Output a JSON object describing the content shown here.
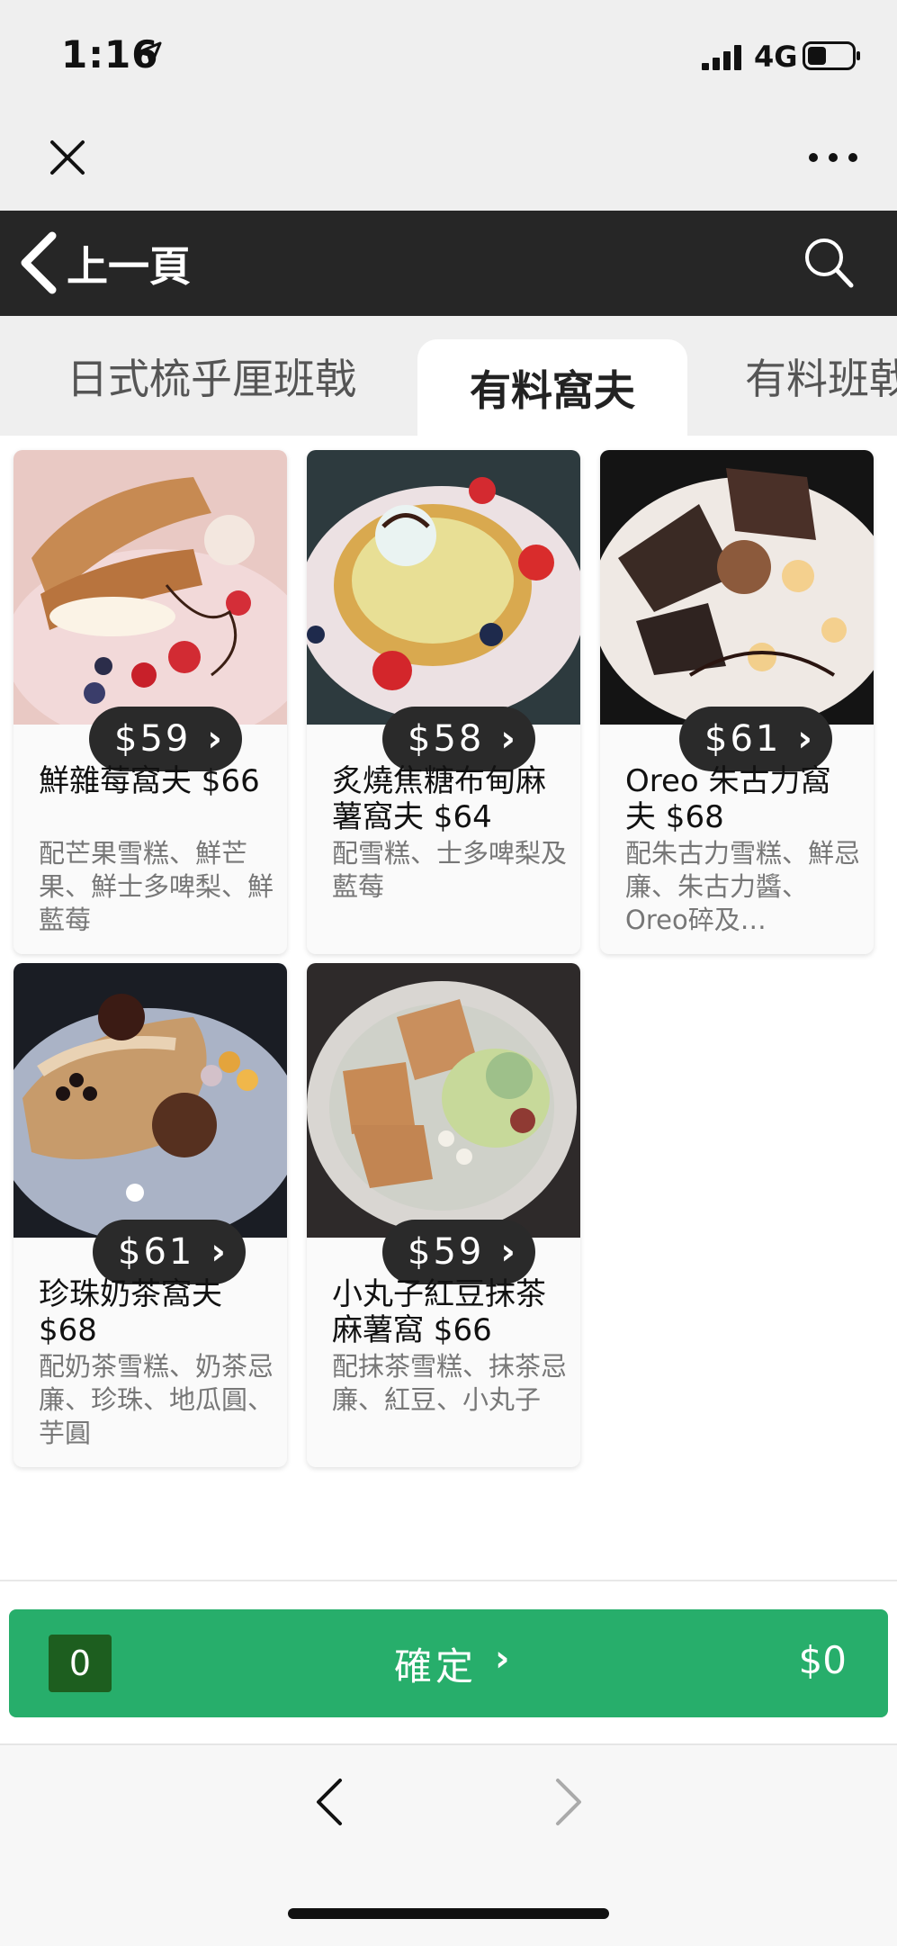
{
  "status": {
    "time": "1:16",
    "network": "4G",
    "icons": [
      "location-arrow-icon",
      "signal-icon",
      "battery-icon"
    ]
  },
  "wechat_bar": {
    "close_icon": "close-icon",
    "more_icon": "more-icon"
  },
  "nav": {
    "back_label": "上一頁",
    "search_icon": "search-icon"
  },
  "tabs": [
    {
      "label": "日式梳乎厘班戟",
      "active": false
    },
    {
      "label": "有料窩夫",
      "active": true
    },
    {
      "label": "有料班戟",
      "active": false
    }
  ],
  "products": [
    {
      "price": "$59",
      "title": "鮮雜莓窩夫 $66",
      "desc": "配芒果雪糕、鮮芒果、鮮士多啤梨、鮮藍莓"
    },
    {
      "price": "$58",
      "title": "炙燒焦糖布甸麻薯窩夫 $64",
      "desc": "配雪糕、士多啤梨及藍莓"
    },
    {
      "price": "$61",
      "title": "Oreo 朱古力窩夫 $68",
      "desc": "配朱古力雪糕、鮮忌廉、朱古力醬、Oreo碎及…"
    },
    {
      "price": "$61",
      "title": "珍珠奶茶窩夫 $68",
      "desc": "配奶茶雪糕、奶茶忌廉、珍珠、地瓜圓、芋圓"
    },
    {
      "price": "$59",
      "title": "小丸子紅豆抹茶麻薯窩 $66",
      "desc": "配抹茶雪糕、抹茶忌廉、紅豆、小丸子"
    }
  ],
  "cart": {
    "quantity": "0",
    "confirm_label": "確定",
    "total": "$0"
  },
  "colors": {
    "nav_bg": "#262626",
    "confirm_green": "#27ae6b",
    "qty_badge": "#1d5e1f"
  }
}
